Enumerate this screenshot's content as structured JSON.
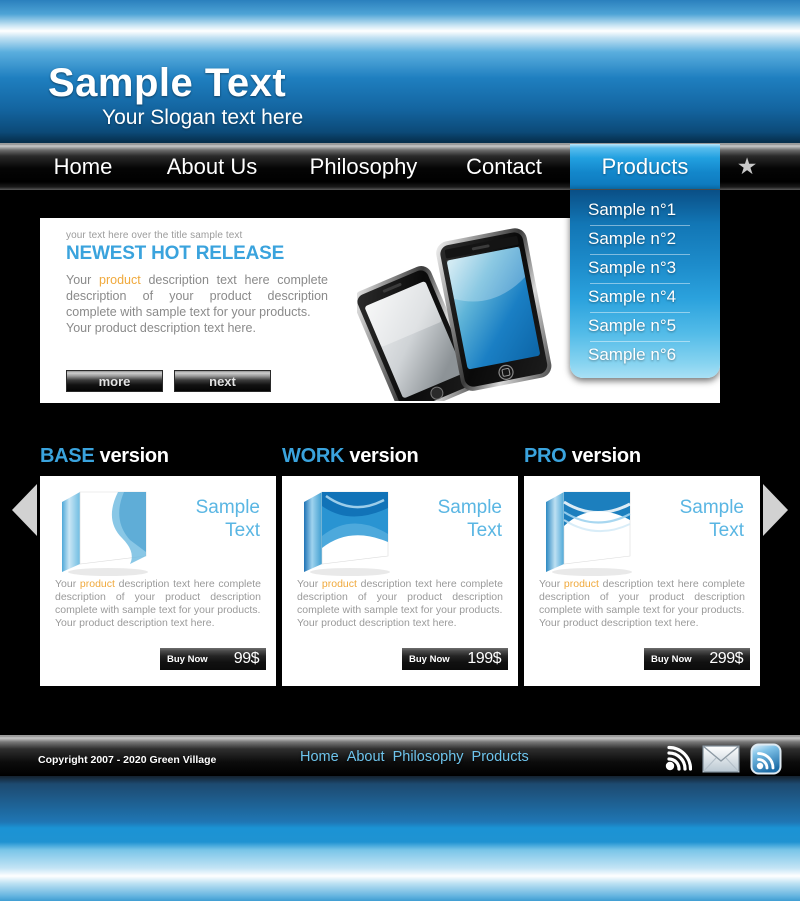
{
  "header": {
    "title": "Sample Text",
    "slogan": "Your Slogan text here"
  },
  "nav": {
    "items": [
      {
        "label": "Home",
        "active": false
      },
      {
        "label": "About Us",
        "active": false
      },
      {
        "label": "Philosophy",
        "active": false
      },
      {
        "label": "Contact",
        "active": false
      },
      {
        "label": "Products",
        "active": true
      }
    ],
    "star_icon": "★"
  },
  "dropdown": {
    "items": [
      {
        "label": "Sample n°1"
      },
      {
        "label": "Sample n°2"
      },
      {
        "label": "Sample n°3"
      },
      {
        "label": "Sample n°4"
      },
      {
        "label": "Sample n°5"
      },
      {
        "label": "Sample n°6"
      }
    ]
  },
  "hero": {
    "eyebrow": "your text here over the title sample text",
    "title": "NEWEST HOT RELEASE",
    "body_pre": "Your ",
    "body_highlight": "product",
    "body_post": " description text here complete description of your product description complete with sample text for your products.",
    "body_last": "Your product description text here.",
    "button_more": "more",
    "button_next": "next",
    "prev_arrow": "prev-arrow",
    "next_arrow": "next-arrow"
  },
  "cards": [
    {
      "heading_accent": "BASE",
      "heading_rest": " version",
      "sample_line1": "Sample",
      "sample_line2": "Text",
      "body_pre": "Your ",
      "body_highlight": "product",
      "body_post": " description text here complete description of your product description complete with sample text for your products.",
      "body_last": "Your product description text here.",
      "buy_label": "Buy Now",
      "price": "99$"
    },
    {
      "heading_accent": "WORK",
      "heading_rest": " version",
      "sample_line1": "Sample",
      "sample_line2": "Text",
      "body_pre": "Your ",
      "body_highlight": "product",
      "body_post": " description text here complete description of your product description complete with sample text for your products.",
      "body_last": "Your product description text here.",
      "buy_label": "Buy Now",
      "price": "199$"
    },
    {
      "heading_accent": "PRO",
      "heading_rest": " version",
      "sample_line1": "Sample",
      "sample_line2": "Text",
      "body_pre": "Your ",
      "body_highlight": "product",
      "body_post": " description text here complete description of your product description complete with sample text for your products.",
      "body_last": "Your product description text here.",
      "buy_label": "Buy Now",
      "price": "299$"
    }
  ],
  "footer": {
    "copyright": "Copyright 2007 - 2020  Green Village",
    "links": [
      {
        "label": "Home"
      },
      {
        "label": "About"
      },
      {
        "label": "Philosophy"
      },
      {
        "label": "Products"
      }
    ],
    "social": [
      {
        "name": "wifi-signal-icon"
      },
      {
        "name": "envelope-icon"
      },
      {
        "name": "rss-feed-icon"
      }
    ]
  },
  "colors": {
    "accent_blue": "#3aa3dd",
    "light_blue": "#5ab6e3",
    "nav_active": "#1387cb",
    "highlight_orange": "#f0a93c",
    "footer_link": "#6ec4ec"
  }
}
